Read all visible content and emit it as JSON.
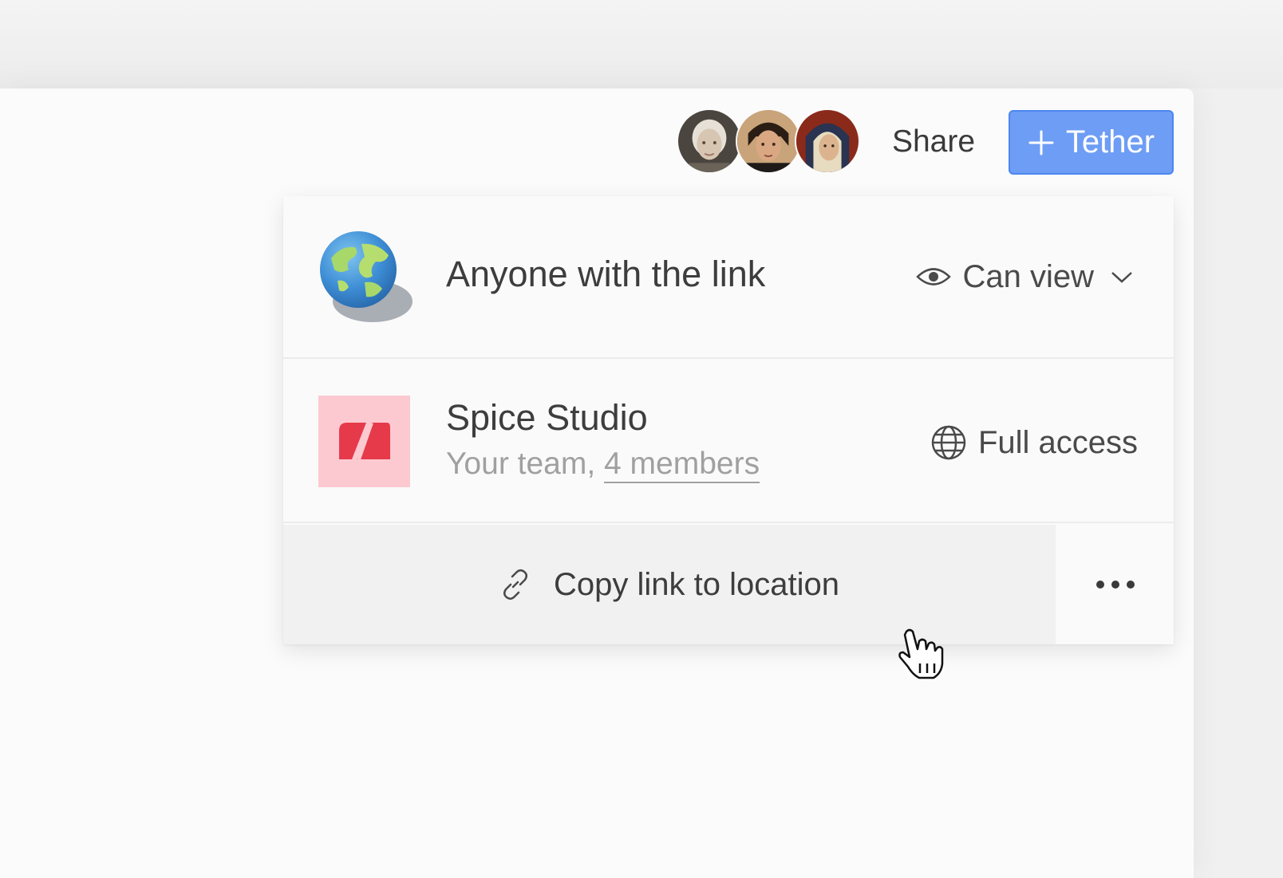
{
  "header": {
    "avatars": [
      {
        "name": "avatar-1"
      },
      {
        "name": "avatar-2"
      },
      {
        "name": "avatar-3"
      }
    ],
    "share_label": "Share",
    "tether_label": "Tether",
    "tether_icon": "plus-icon",
    "colors": {
      "tether_bg": "#6e9df5",
      "tether_border": "#4d86f0"
    }
  },
  "share_panel": {
    "link_row": {
      "icon": "globe-icon",
      "title": "Anyone with the link",
      "permission_icon": "eye-icon",
      "permission_label": "Can view",
      "dropdown_icon": "chevron-down-icon"
    },
    "team_row": {
      "icon": "team-logo",
      "name": "Spice Studio",
      "subtitle_prefix": "Your team, ",
      "members_link": "4 members",
      "access_icon": "globe-outline-icon",
      "access_label": "Full access",
      "colors": {
        "logo_bg": "#fcc9d1",
        "logo_mark": "#e63a4a"
      }
    },
    "actions": {
      "copy_icon": "link-icon",
      "copy_label": "Copy link to location",
      "more_icon": "more-horizontal-icon"
    }
  },
  "cursor": {
    "icon": "hand-pointer-icon"
  }
}
